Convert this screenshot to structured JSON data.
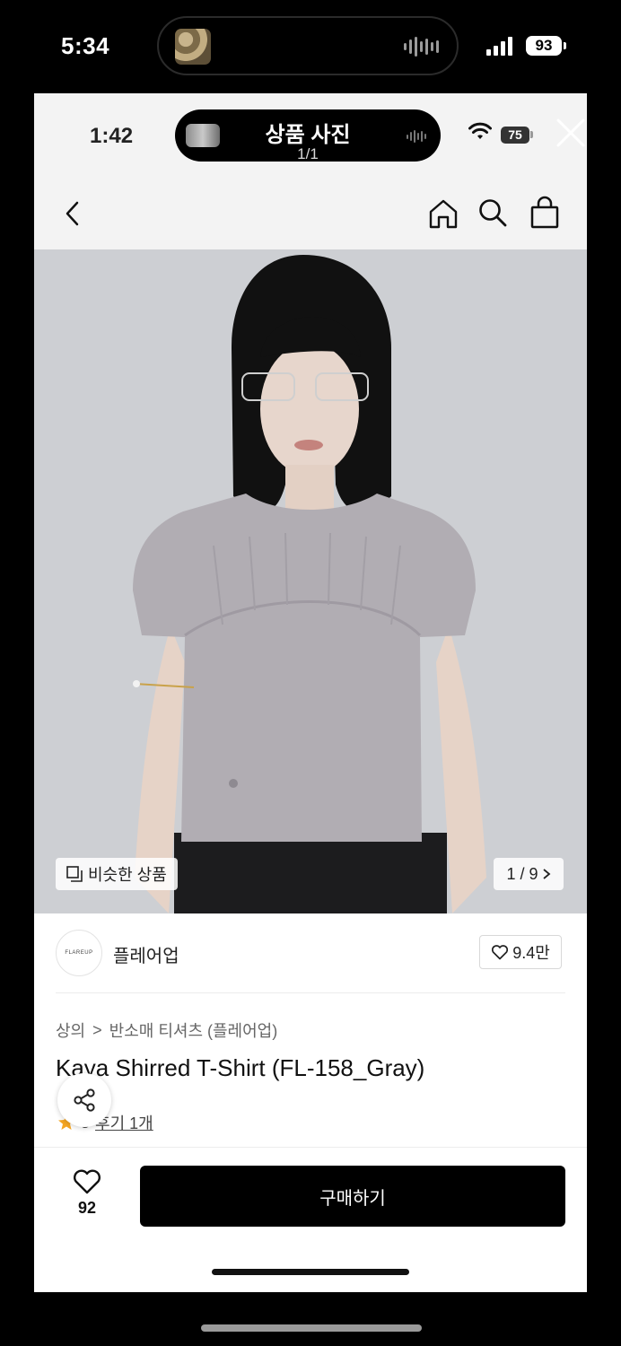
{
  "outer_status": {
    "time": "5:34",
    "battery": "93"
  },
  "inner_status": {
    "time": "1:42",
    "battery": "75"
  },
  "viewer": {
    "title": "상품 사진",
    "counter": "1/1"
  },
  "photo": {
    "similar_label": "비슷한 상품",
    "page_counter": "1 / 9"
  },
  "brand": {
    "logo_text": "FLAREUP",
    "name": "플레어업",
    "likes": "9.4만"
  },
  "breadcrumb": {
    "category": "상의",
    "separator": ">",
    "subcategory": "반소매 티셔츠 (플레어업)"
  },
  "product": {
    "title": "Kaya Shirred T-Shirt (FL-158_Gray)",
    "rating_digit": "5",
    "review_link": "후기 1개"
  },
  "bottom_bar": {
    "favorite_count": "92",
    "buy_label": "구매하기"
  },
  "colors": {
    "buy_button": "#000000",
    "star": "#f5a623",
    "photo_bg": "#cdcfd3"
  }
}
